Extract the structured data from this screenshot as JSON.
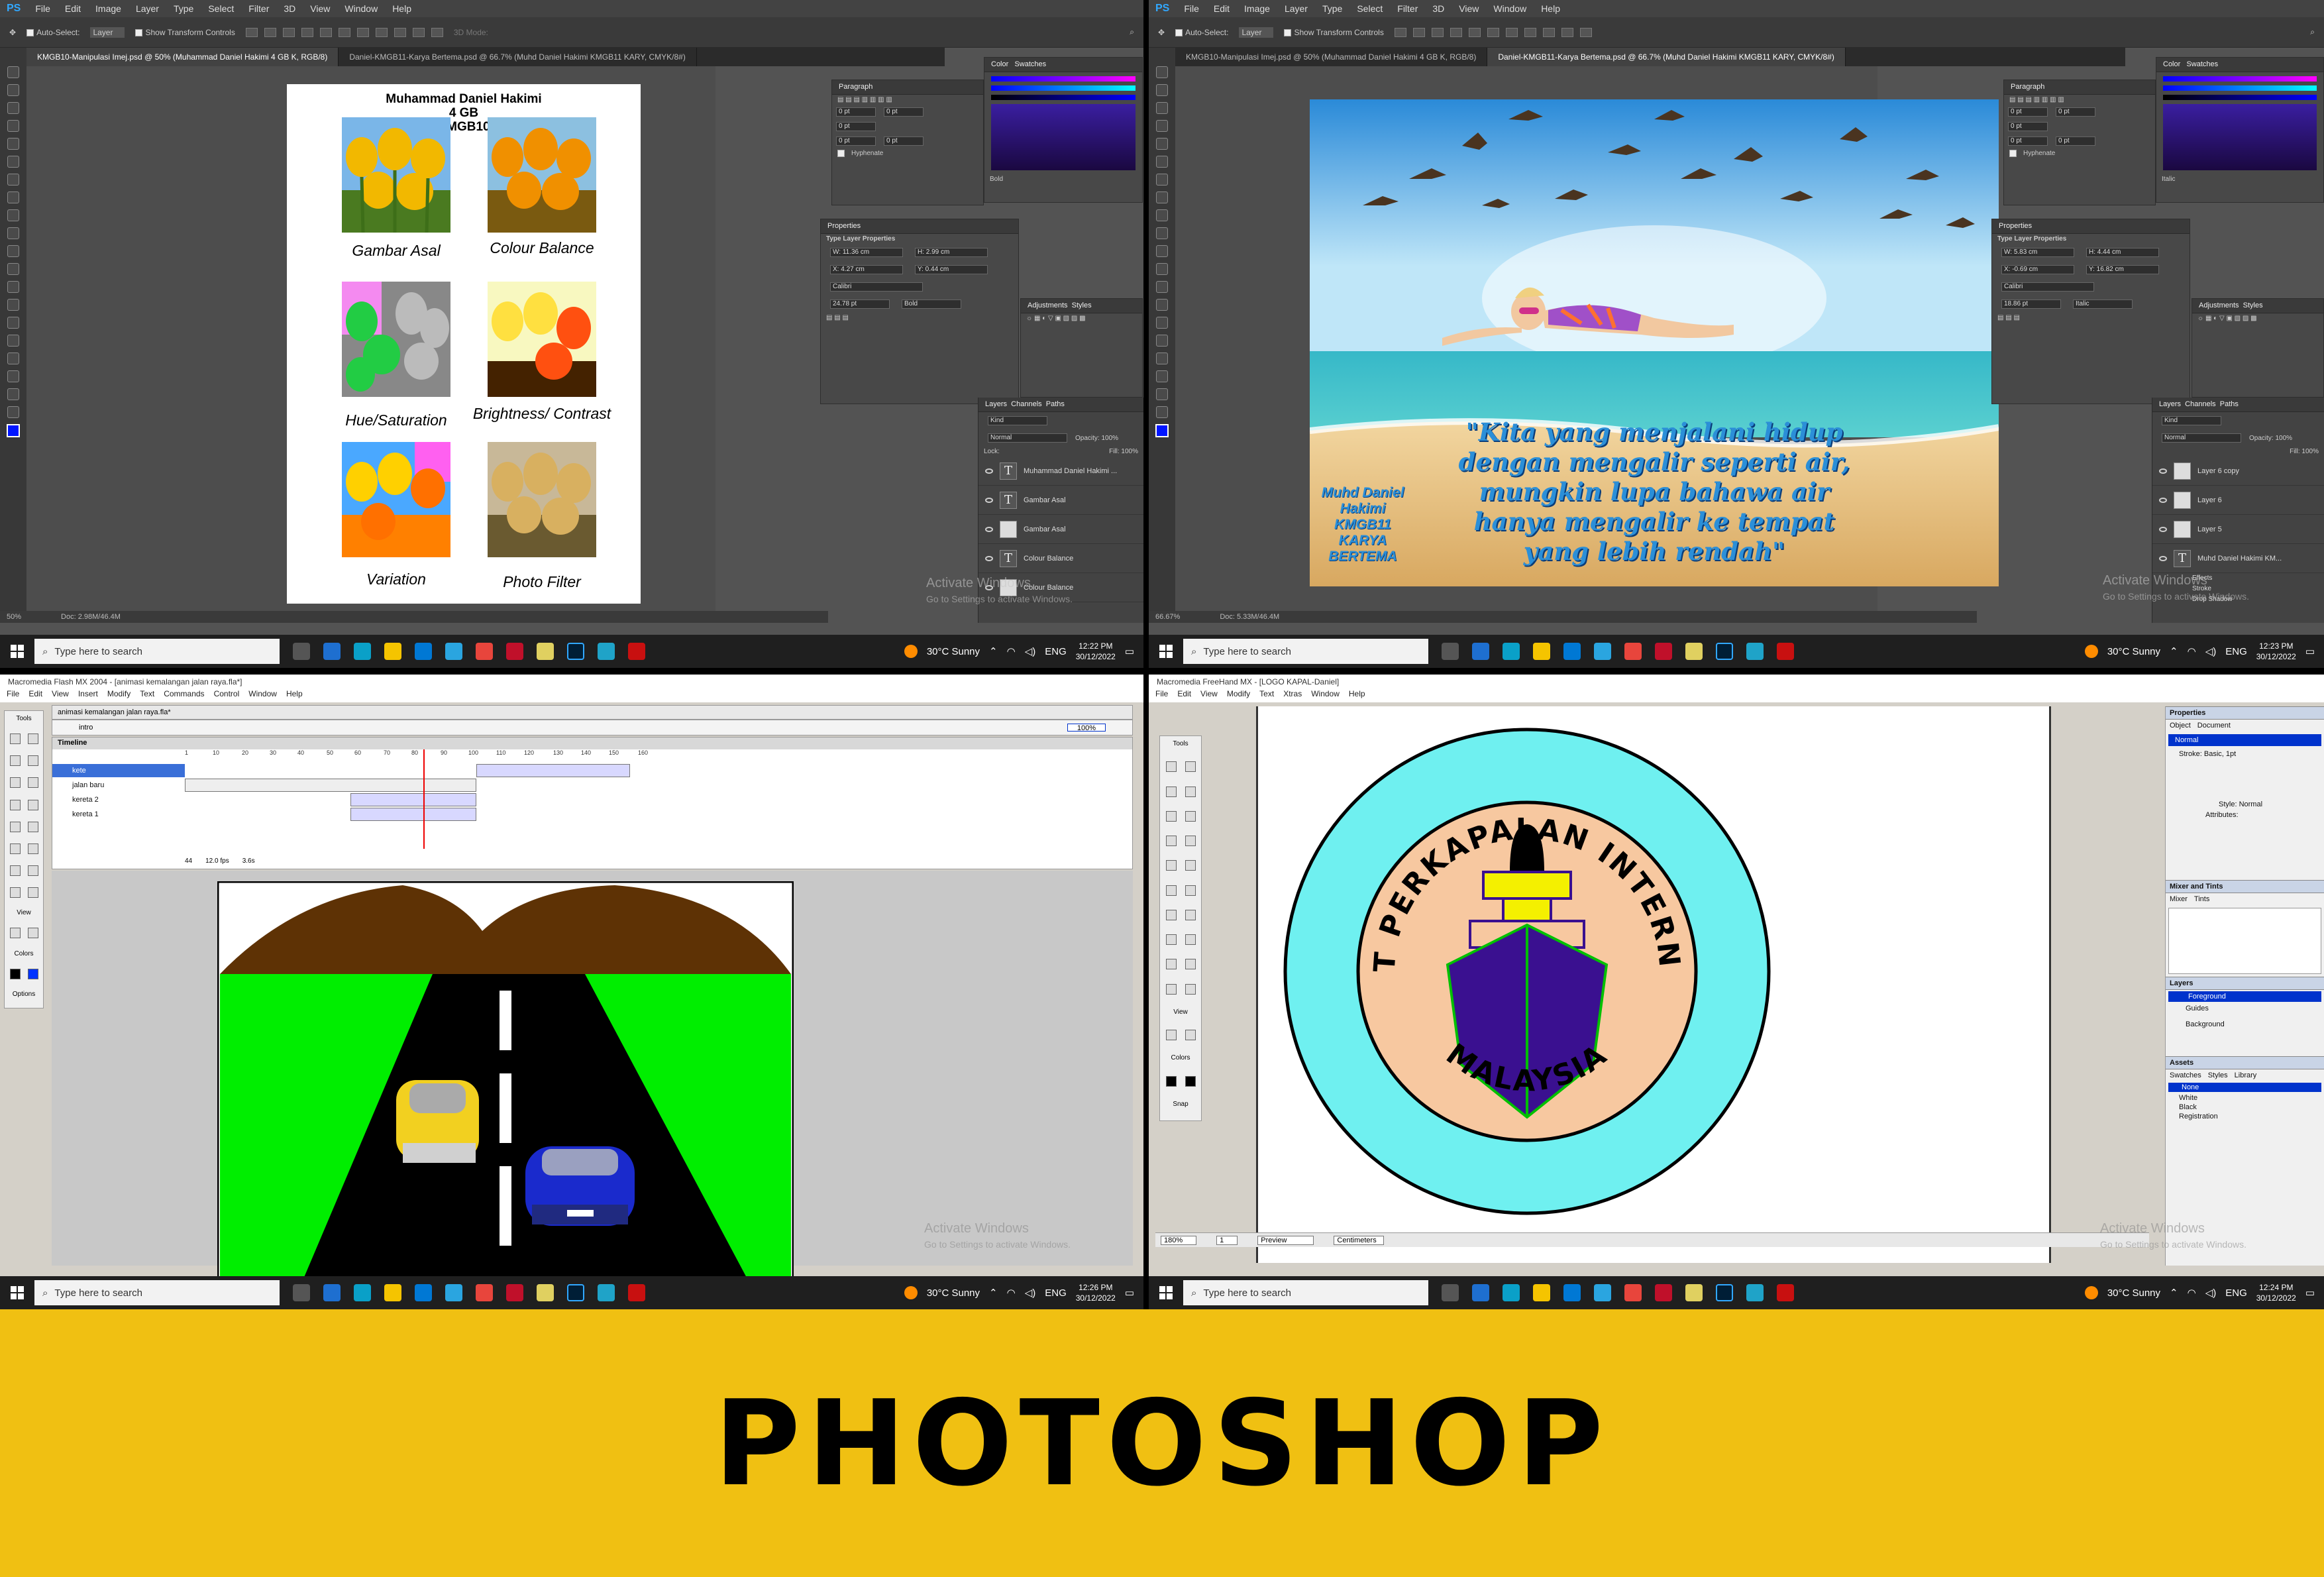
{
  "q1": {
    "menu": [
      "PS",
      "File",
      "Edit",
      "Image",
      "Layer",
      "Type",
      "Select",
      "Filter",
      "3D",
      "View",
      "Window",
      "Help"
    ],
    "options": {
      "auto_select": "Auto-Select:",
      "layer": "Layer",
      "transform": "Show Transform Controls",
      "mode3d": "3D Mode:"
    },
    "tabs": [
      "KMGB10-Manipulasi Imej.psd @ 50% (Muhammad Daniel Hakimi 4 GB K, RGB/8)",
      "Daniel-KMGB11-Karya Bertema.psd @ 66.7% (Muhd Daniel Hakimi KMGB11 KARY, CMYK/8#)"
    ],
    "doc": {
      "header": [
        "Muhammad Daniel Hakimi",
        "4 GB",
        "KMGB10"
      ],
      "captions": [
        "Gambar Asal",
        "Colour Balance",
        "Hue/Saturation",
        "Brightness/ Contrast",
        "Variation",
        "Photo Filter"
      ]
    },
    "panels": {
      "paragraph": "Paragraph",
      "swatches_tabs": [
        "Color",
        "Swatches"
      ],
      "pt": "0 pt",
      "hyphenate": "Hyphenate",
      "bold": "Bold",
      "properties": "Properties",
      "type_layer": "Type Layer Properties",
      "w": "W: 11.36 cm",
      "h": "H: 2.99 cm",
      "x": "X: 4.27 cm",
      "y": "Y: 0.44 cm",
      "font": "Calibri",
      "size": "24.78 pt",
      "style": "Bold",
      "layers_tabs": [
        "Layers",
        "Channels",
        "Paths"
      ],
      "kind": "Kind",
      "normal": "Normal",
      "opacity": "Opacity: 100%",
      "lock": "Lock:",
      "fill": "Fill: 100%",
      "layers": [
        "Muhammad Daniel Hakimi ...",
        "Gambar Asal",
        "Gambar Asal",
        "Colour Balance",
        "Colour Balance"
      ],
      "adjustments": [
        "Adjustments",
        "Styles"
      ]
    },
    "status": [
      "50%",
      "Doc: 2.98M/46.4M"
    ],
    "watermark": {
      "title": "Activate Windows",
      "sub": "Go to Settings to activate Windows."
    },
    "taskbar": {
      "search": "Type here to search",
      "weather": "30°C  Sunny",
      "lang": "ENG",
      "time": "12:22 PM",
      "date": "30/12/2022"
    }
  },
  "q2": {
    "menu": [
      "PS",
      "File",
      "Edit",
      "Image",
      "Layer",
      "Type",
      "Select",
      "Filter",
      "3D",
      "View",
      "Window",
      "Help"
    ],
    "tabs": [
      "KMGB10-Manipulasi Imej.psd @ 50% (Muhammad Daniel Hakimi 4 GB K, RGB/8)",
      "Daniel-KMGB11-Karya Bertema.psd @ 66.7% (Muhd Daniel Hakimi KMGB11 KARY, CMYK/8#)"
    ],
    "quote": [
      "\"Kita yang menjalani hidup",
      "dengan mengalir seperti air,",
      "mungkin lupa bahawa air",
      "hanya mengalir ke tempat",
      "yang lebih rendah\""
    ],
    "credit": [
      "Muhd Daniel",
      "Hakimi",
      "KMGB11",
      "KARYA",
      "BERTEMA"
    ],
    "panels": {
      "paragraph": "Paragraph",
      "swatches_tabs": [
        "Color",
        "Swatches"
      ],
      "pt": "0 pt",
      "hyphenate": "Hyphenate",
      "italic": "Italic",
      "properties": "Properties",
      "type_layer": "Type Layer Properties",
      "w": "W: 5.83 cm",
      "h": "H: 4.44 cm",
      "x": "X: -0.69 cm",
      "y": "Y: 16.82 cm",
      "font": "Calibri",
      "size": "18.86 pt",
      "style": "Italic",
      "layers": [
        "Layer 6 copy",
        "Layer 6",
        "Layer 5",
        "Muhd Daniel Hakimi KM..."
      ],
      "effects": [
        "Effects",
        "Stroke",
        "Drop Shadow"
      ],
      "adjustments": [
        "Adjustments",
        "Styles"
      ],
      "layers_tabs": [
        "Layers",
        "Channels",
        "Paths"
      ],
      "kind": "Kind",
      "normal": "Normal",
      "opacity": "Opacity: 100%",
      "fill": "Fill: 100%"
    },
    "status": [
      "66.67%",
      "Doc: 5.33M/46.4M"
    ],
    "watermark": {
      "title": "Activate Windows",
      "sub": "Go to Settings to activate Windows."
    },
    "taskbar": {
      "search": "Type here to search",
      "weather": "30°C  Sunny",
      "lang": "ENG",
      "time": "12:23 PM",
      "date": "30/12/2022"
    }
  },
  "q3": {
    "title": "Macromedia Flash MX 2004 - [animasi kemalangan jalan raya.fla*]",
    "menu": [
      "File",
      "Edit",
      "View",
      "Insert",
      "Modify",
      "Text",
      "Commands",
      "Control",
      "Window",
      "Help"
    ],
    "doc_tab": "animasi kemalangan jalan raya.fla*",
    "scene": "intro",
    "timeline": "Timeline",
    "layers": [
      "kete",
      "jalan baru",
      "kereta 2",
      "kereta 1"
    ],
    "frames": [
      "1",
      "5",
      "10",
      "15",
      "20",
      "25",
      "30",
      "35",
      "40",
      "45",
      "50",
      "55",
      "60",
      "65",
      "70",
      "75",
      "80",
      "85",
      "90",
      "95",
      "100",
      "105",
      "110",
      "115",
      "120",
      "125",
      "130",
      "135",
      "140",
      "145",
      "150",
      "155",
      "160",
      "165"
    ],
    "fps": "12.0 fps",
    "time": "3.6s",
    "frame_no": "44",
    "zoom": "100%",
    "tools": [
      "Tools",
      "View",
      "Colors",
      "Options"
    ],
    "watermark": {
      "title": "Activate Windows",
      "sub": "Go to Settings to activate Windows."
    },
    "taskbar": {
      "search": "Type here to search",
      "weather": "30°C  Sunny",
      "lang": "ENG",
      "time": "12:26 PM",
      "date": "30/12/2022"
    }
  },
  "q4": {
    "title": "Macromedia FreeHand MX - [LOGO KAPAL-Daniel]",
    "menu": [
      "File",
      "Edit",
      "View",
      "Modify",
      "Text",
      "Xtras",
      "Window",
      "Help"
    ],
    "logo": {
      "top": "SYARIKAT PERKAPALAN INTERNATIONAL",
      "bottom": "MALAYSIA"
    },
    "panel": {
      "properties": "Properties",
      "tabs": [
        "Object",
        "Document"
      ],
      "normal": "Normal",
      "stroke": "Stroke: Basic, 1pt",
      "style": "Style: Normal",
      "attributes": "Attributes:",
      "mixer": "Mixer and Tints",
      "mixer_tabs": [
        "Mixer",
        "Tints"
      ],
      "layers": "Layers",
      "layer_names": [
        "Foreground",
        "Guides",
        "Background"
      ],
      "assets": "Assets",
      "asset_tabs": [
        "Swatches",
        "Styles",
        "Library"
      ],
      "swatches": [
        "None",
        "White",
        "Black",
        "Registration"
      ]
    },
    "tools": [
      "Tools",
      "View",
      "Colors",
      "Snap"
    ],
    "status": {
      "zoom": "180%",
      "page": "1",
      "preview": "Preview",
      "units": "Centimeters"
    },
    "watermark": {
      "title": "Activate Windows",
      "sub": "Go to Settings to activate Windows."
    },
    "taskbar": {
      "search": "Type here to search",
      "weather": "30°C  Sunny",
      "lang": "ENG",
      "time": "12:24 PM",
      "date": "30/12/2022"
    }
  },
  "banner": {
    "text": "PHOTOSHOP"
  },
  "colors": {
    "banner": "#f0c012",
    "ps_accent": "#31a8ff",
    "fh_ring": "#6ff0f0",
    "fh_inner": "#f7c8a0",
    "ship": "#3a1090",
    "grass": "#00ee00",
    "hill": "#5e3205"
  }
}
